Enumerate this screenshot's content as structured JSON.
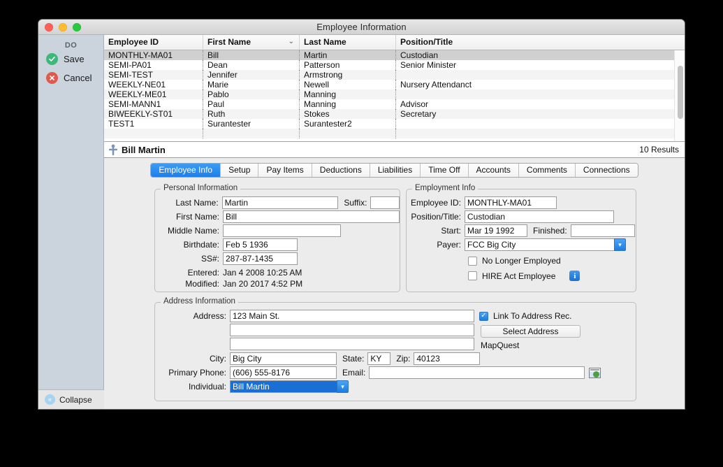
{
  "window": {
    "title": "Employee Information"
  },
  "sidebar": {
    "section_label": "DO",
    "actions": [
      {
        "label": "Save",
        "icon": "check-circle-icon",
        "color": "#3cb878"
      },
      {
        "label": "Cancel",
        "icon": "x-circle-icon",
        "color": "#e2584d"
      }
    ],
    "collapse": {
      "label": "Collapse",
      "icon": "chevron-double-left-icon"
    }
  },
  "table": {
    "columns": [
      {
        "key": "employee_id",
        "label": "Employee ID",
        "sorted": false
      },
      {
        "key": "first_name",
        "label": "First Name",
        "sorted": true,
        "sort_glyph": "⌄"
      },
      {
        "key": "last_name",
        "label": "Last Name",
        "sorted": false
      },
      {
        "key": "position",
        "label": "Position/Title",
        "sorted": false
      }
    ],
    "rows": [
      {
        "employee_id": "MONTHLY-MA01",
        "first_name": "Bill",
        "last_name": "Martin",
        "position": "Custodian",
        "selected": true
      },
      {
        "employee_id": "SEMI-PA01",
        "first_name": "Dean",
        "last_name": "Patterson",
        "position": "Senior Minister",
        "selected": false
      },
      {
        "employee_id": "SEMI-TEST",
        "first_name": "Jennifer",
        "last_name": "Armstrong",
        "position": "",
        "selected": false
      },
      {
        "employee_id": "WEEKLY-NE01",
        "first_name": "Marie",
        "last_name": "Newell",
        "position": "Nursery Attendanct",
        "selected": false
      },
      {
        "employee_id": "WEEKLY-ME01",
        "first_name": "Pablo",
        "last_name": "Manning",
        "position": "",
        "selected": false
      },
      {
        "employee_id": "SEMI-MANN1",
        "first_name": "Paul",
        "last_name": "Manning",
        "position": "Advisor",
        "selected": false
      },
      {
        "employee_id": "BIWEEKLY-ST01",
        "first_name": "Ruth",
        "last_name": "Stokes",
        "position": "Secretary",
        "selected": false
      },
      {
        "employee_id": "TEST1",
        "first_name": "Surantester",
        "last_name": "Surantester2",
        "position": "",
        "selected": false
      }
    ]
  },
  "record": {
    "icon": "person-icon",
    "name": "Bill Martin",
    "results": "10 Results"
  },
  "tabs": [
    {
      "label": "Employee Info",
      "active": true
    },
    {
      "label": "Setup",
      "active": false
    },
    {
      "label": "Pay Items",
      "active": false
    },
    {
      "label": "Deductions",
      "active": false
    },
    {
      "label": "Liabilities",
      "active": false
    },
    {
      "label": "Time Off",
      "active": false
    },
    {
      "label": "Accounts",
      "active": false
    },
    {
      "label": "Comments",
      "active": false
    },
    {
      "label": "Connections",
      "active": false
    }
  ],
  "personal_information": {
    "title": "Personal Information",
    "last_name_label": "Last Name:",
    "last_name_value": "Martin",
    "suffix_label": "Suffix:",
    "suffix_value": "",
    "first_name_label": "First Name:",
    "first_name_value": "Bill",
    "middle_name_label": "Middle Name:",
    "middle_name_value": "",
    "birthdate_label": "Birthdate:",
    "birthdate_value": "Feb 5 1936",
    "ssn_label": "SS#:",
    "ssn_value": "287-87-1435",
    "entered_label": "Entered:",
    "entered_value": "Jan 4 2008 10:25 AM",
    "modified_label": "Modified:",
    "modified_value": "Jan 20 2017 4:52 PM"
  },
  "employment_info": {
    "title": "Employment Info",
    "employee_id_label": "Employee ID:",
    "employee_id_value": "MONTHLY-MA01",
    "position_label": "Position/Title:",
    "position_value": "Custodian",
    "start_label": "Start:",
    "start_value": "Mar 19 1992",
    "finished_label": "Finished:",
    "finished_value": "",
    "payer_label": "Payer:",
    "payer_value": "FCC Big City",
    "no_longer_employed_label": "No Longer Employed",
    "no_longer_employed_checked": false,
    "hire_act_label": "HIRE Act Employee",
    "hire_act_checked": false,
    "help_glyph": "i"
  },
  "address_information": {
    "title": "Address Information",
    "address_label": "Address:",
    "address_line1": "123 Main St.",
    "address_line2": "",
    "address_line3": "",
    "city_label": "City:",
    "city_value": "Big City",
    "state_label": "State:",
    "state_value": "KY",
    "zip_label": "Zip:",
    "zip_value": "40123",
    "primary_phone_label": "Primary Phone:",
    "primary_phone_value": "(606) 555-8176",
    "email_label": "Email:",
    "email_value": "",
    "individual_label": "Individual:",
    "individual_value": "Bill Martin",
    "link_address_label": "Link To Address Rec.",
    "link_address_checked": true,
    "select_address_label": "Select Address",
    "mapquest_label": "MapQuest"
  },
  "colors": {
    "accent_blue": "#1a7de4",
    "save_green": "#3cb878",
    "cancel_red": "#e2584d",
    "sidebar_bg": "#cbd3dd",
    "window_bg": "#ececec"
  }
}
